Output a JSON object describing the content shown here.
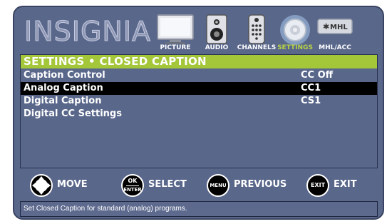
{
  "brand": "INSIGNIA",
  "tabs": [
    {
      "label": "PICTURE",
      "icon": "picture-icon",
      "active": false
    },
    {
      "label": "AUDIO",
      "icon": "speaker-icon",
      "active": false
    },
    {
      "label": "CHANNELS",
      "icon": "remote-icon",
      "active": false
    },
    {
      "label": "SETTINGS",
      "icon": "gear-icon",
      "active": true
    },
    {
      "label": "MHL/ACC",
      "icon": "mhl-icon",
      "badge": "MHL",
      "active": false
    }
  ],
  "banner": "SETTINGS • CLOSED CAPTION",
  "menu": [
    {
      "label": "Caption Control",
      "value": "CC Off",
      "selected": false
    },
    {
      "label": "Analog Caption",
      "value": "CC1",
      "selected": true
    },
    {
      "label": "Digital Caption",
      "value": "CS1",
      "selected": false
    },
    {
      "label": "Digital CC Settings",
      "value": "",
      "selected": false
    }
  ],
  "hints": [
    {
      "button": "",
      "label": "MOVE",
      "icon": "dpad-icon"
    },
    {
      "button": "OK/ENTER",
      "button_top": "OK",
      "button_bottom": "ENTER",
      "label": "SELECT"
    },
    {
      "button": "MENU",
      "label": "PREVIOUS"
    },
    {
      "button": "EXIT",
      "label": "EXIT"
    }
  ],
  "status": "Set Closed Caption for standard (analog) programs.",
  "colors": {
    "background": "#59678b",
    "accent": "#a4c639",
    "selected_row": "#000000",
    "active_tab_label": "#b8d246"
  }
}
